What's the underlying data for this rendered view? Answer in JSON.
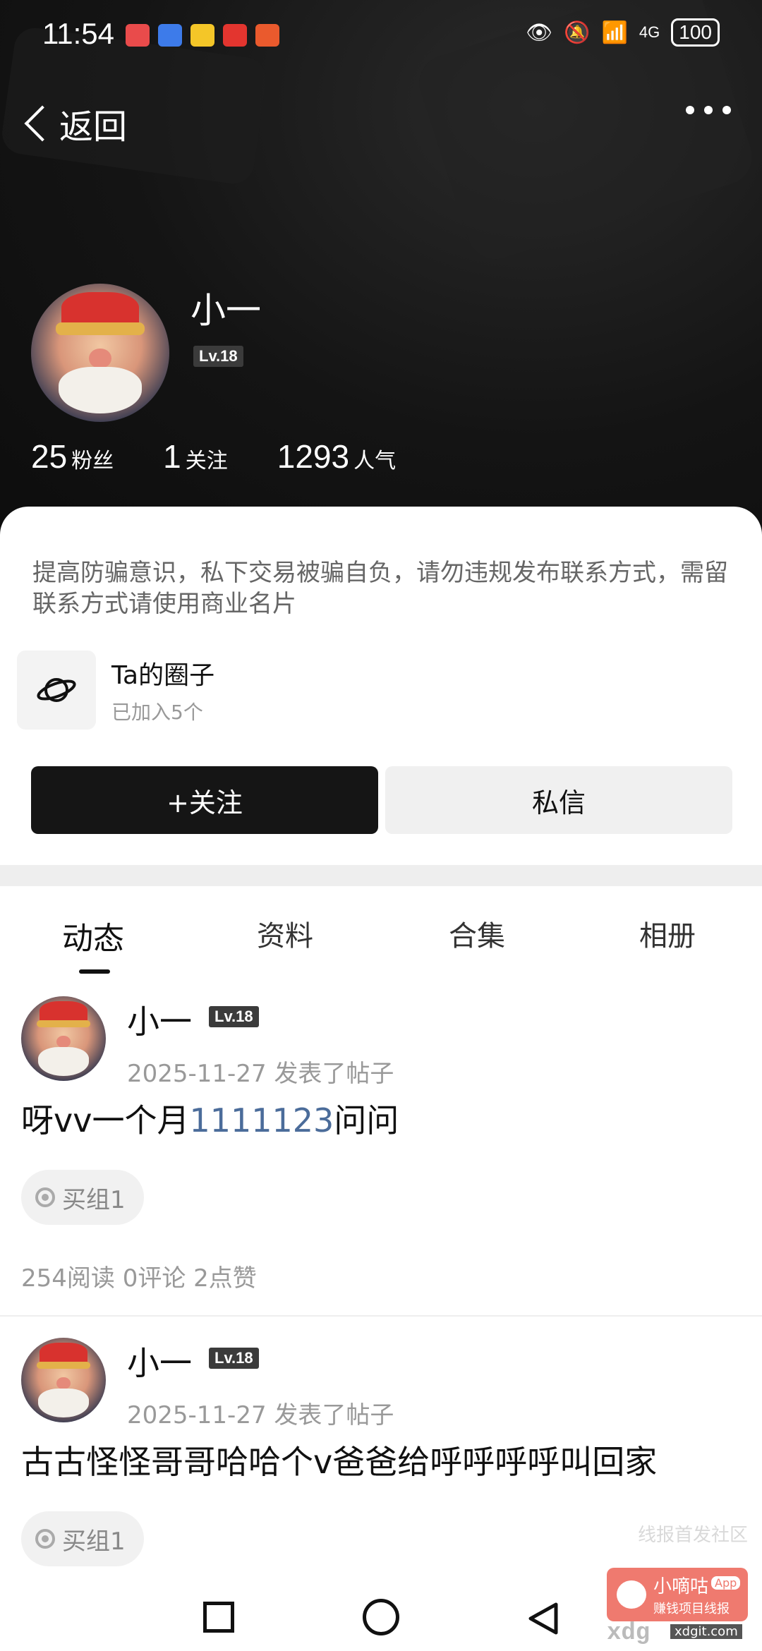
{
  "status_bar": {
    "time": "11:54",
    "network": "4G",
    "battery": "100"
  },
  "nav": {
    "back_label": "返回"
  },
  "profile": {
    "name": "小一",
    "level": "Lv.18",
    "stats": [
      {
        "value": "25",
        "label": "粉丝"
      },
      {
        "value": "1",
        "label": "关注"
      },
      {
        "value": "1293",
        "label": "人气"
      }
    ],
    "notice": "提高防骗意识，私下交易被骗自负，请勿违规发布联系方式，需留联系方式请使用商业名片",
    "circle": {
      "title": "Ta的圈子",
      "subtitle": "已加入5个"
    },
    "follow_label": "+关注",
    "message_label": "私信"
  },
  "tabs": [
    {
      "label": "动态",
      "active": true
    },
    {
      "label": "资料",
      "active": false
    },
    {
      "label": "合集",
      "active": false
    },
    {
      "label": "相册",
      "active": false
    }
  ],
  "posts": [
    {
      "author": "小一",
      "level": "Lv.18",
      "date": "2025-11-27",
      "action": "发表了帖子",
      "content_prefix": "呀vv一个月",
      "content_link": "1111123",
      "content_suffix": "问问",
      "tag": "买组1",
      "meta": "254阅读 0评论 2点赞"
    },
    {
      "author": "小一",
      "level": "Lv.18",
      "date": "2025-11-27",
      "action": "发表了帖子",
      "content_prefix": "古古怪怪哥哥哈哈个v爸爸给呼呼呼呼叫回家",
      "content_link": "",
      "content_suffix": "",
      "tag": "买组1"
    }
  ],
  "watermark": {
    "text": "线报首发社区",
    "brand": "小嘀咕",
    "brand_badge": "App",
    "slogan": "赚钱项目线报",
    "url": "xdg",
    "url_small": "xdgit.com"
  },
  "colors": {
    "header_bg": "#141414",
    "link_blue": "#4b6c9a",
    "follow_bg": "#151515"
  }
}
